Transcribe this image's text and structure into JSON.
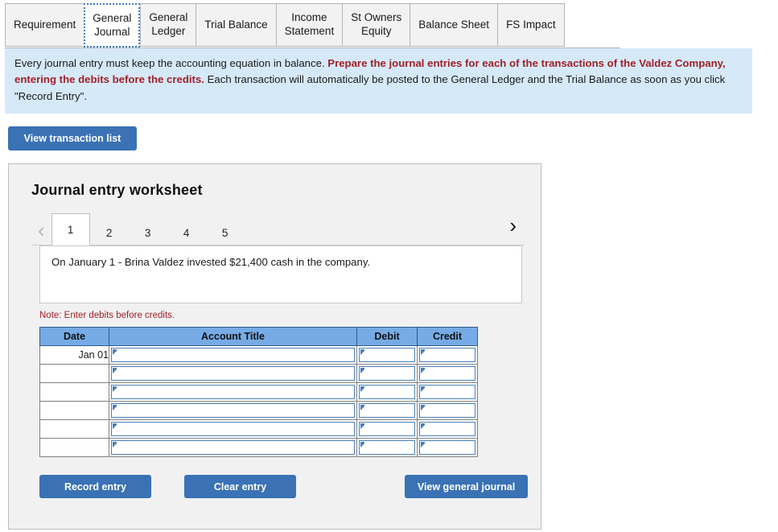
{
  "tabs": [
    {
      "label": "Requirement",
      "active": false
    },
    {
      "label": "General\nJournal",
      "active": true
    },
    {
      "label": "General\nLedger",
      "active": false
    },
    {
      "label": "Trial Balance",
      "active": false
    },
    {
      "label": "Income\nStatement",
      "active": false
    },
    {
      "label": "St Owners\nEquity",
      "active": false
    },
    {
      "label": "Balance Sheet",
      "active": false
    },
    {
      "label": "FS Impact",
      "active": false
    }
  ],
  "banner": {
    "part1": "Every journal entry must keep the accounting equation in balance.",
    "emphasis": "Prepare the journal entries for each of the transactions of the Valdez Company, entering the debits before the credits.",
    "part2": "Each transaction will automatically be posted to the General Ledger and the Trial Balance as soon as you click \"Record Entry\"."
  },
  "toolbar": {
    "view_transaction_list": "View transaction list"
  },
  "worksheet": {
    "title": "Journal entry worksheet",
    "pager": {
      "prev_icon": "‹",
      "next_icon": "›",
      "pages": [
        "1",
        "2",
        "3",
        "4",
        "5"
      ],
      "active_page": "1"
    },
    "transaction_text": "On January 1 - Brina Valdez invested $21,400 cash in the company.",
    "note": "Note: Enter debits before credits.",
    "table": {
      "headers": [
        "Date",
        "Account Title",
        "Debit",
        "Credit"
      ],
      "rows": [
        {
          "date": "Jan 01",
          "account": "",
          "debit": "",
          "credit": ""
        },
        {
          "date": "",
          "account": "",
          "debit": "",
          "credit": ""
        },
        {
          "date": "",
          "account": "",
          "debit": "",
          "credit": ""
        },
        {
          "date": "",
          "account": "",
          "debit": "",
          "credit": ""
        },
        {
          "date": "",
          "account": "",
          "debit": "",
          "credit": ""
        },
        {
          "date": "",
          "account": "",
          "debit": "",
          "credit": ""
        }
      ]
    },
    "buttons": {
      "record": "Record entry",
      "clear": "Clear entry",
      "view_general_journal": "View general journal"
    }
  },
  "colors": {
    "accent_blue": "#3a72b5",
    "table_header_blue": "#76abe6",
    "banner_bg": "#d6e9f8",
    "panel_bg": "#f1f1f1",
    "emphasis_red": "#a02128"
  }
}
